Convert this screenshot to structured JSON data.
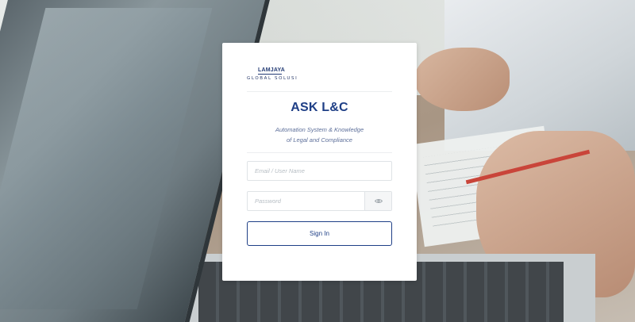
{
  "brand": {
    "logo_top": "LAMJAYA",
    "logo_bottom": "GLOBAL SOLUSI",
    "accent_color": "#1f3f86"
  },
  "login": {
    "title": "ASK L&C",
    "subtitle_line1": "Automation System & Knowledge",
    "subtitle_line2": "of Legal and Compliance",
    "email_placeholder": "Email / User Name",
    "email_value": "",
    "password_placeholder": "Password",
    "password_value": "",
    "password_toggle_icon": "eye-icon",
    "signin_label": "Sign In"
  }
}
